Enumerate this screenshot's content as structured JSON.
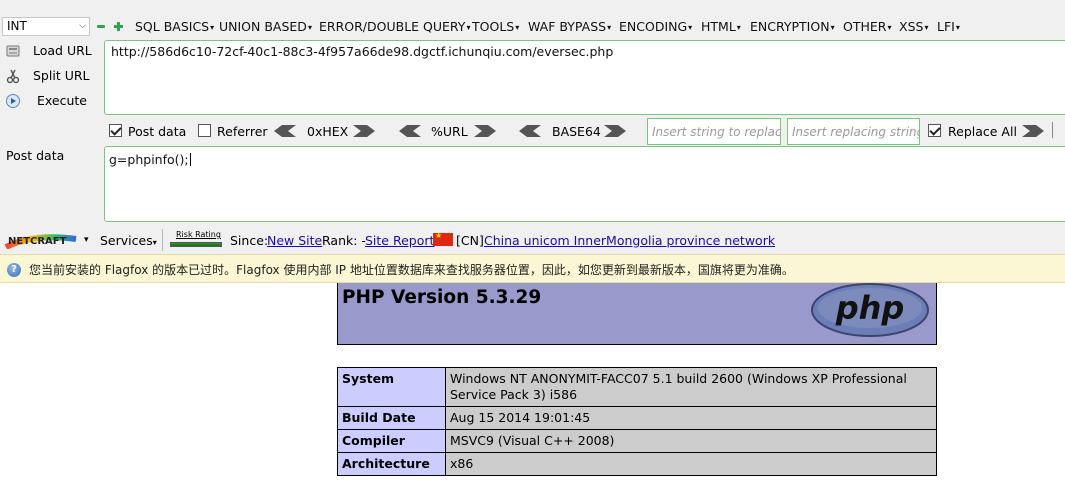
{
  "hackbar": {
    "type_select": {
      "value": "INT"
    },
    "menu": [
      {
        "label": "SQL BASICS"
      },
      {
        "label": "UNION BASED"
      },
      {
        "label": "ERROR/DOUBLE QUERY"
      },
      {
        "label": "TOOLS"
      },
      {
        "label": "WAF BYPASS"
      },
      {
        "label": "ENCODING"
      },
      {
        "label": "HTML"
      },
      {
        "label": "ENCRYPTION"
      },
      {
        "label": "OTHER"
      },
      {
        "label": "XSS"
      },
      {
        "label": "LFI"
      }
    ],
    "side_buttons": {
      "load_url": "Load URL",
      "split_url": "Split URL",
      "execute": "Execute"
    },
    "url_value": "http://586d6c10-72cf-40c1-88c3-4f957a66de98.dgctf.ichunqiu.com/eversec.php",
    "options": {
      "post_data": {
        "label": "Post data",
        "checked": true
      },
      "referrer": {
        "label": "Referrer",
        "checked": false
      },
      "hex": "0xHEX",
      "url": "%URL",
      "base64": "BASE64",
      "insert_string_placeholder": "Insert string to replace",
      "insert_replacing_placeholder": "Insert replacing string",
      "replace_all": {
        "label": "Replace All",
        "checked": true
      }
    },
    "post_label": "Post data",
    "post_value": "g=phpinfo();"
  },
  "netcraft": {
    "logo_text": "NETCRAFT",
    "services": "Services",
    "risk_rating": "Risk Rating",
    "since_label": "Since:",
    "since_value": "New Site",
    "rank_label": "Rank: -",
    "site_report": "Site Report",
    "country": "[CN]",
    "network": "China unicom InnerMongolia province network",
    "flag_color": "#de2910"
  },
  "notice": {
    "text": "您当前安装的 Flagfox 的版本已过时。Flagfox 使用内部 IP 地址位置数据库来查找服务器位置，因此，如您更新到最新版本，国旗将更为准确。"
  },
  "phpinfo": {
    "title": "PHP Version 5.3.29",
    "logo_text": "php",
    "rows": [
      {
        "key": "System",
        "value": "Windows NT ANONYMIT-FACC07 5.1 build 2600 (Windows XP Professional Service Pack 3) i586"
      },
      {
        "key": "Build Date",
        "value": "Aug 15 2014 19:01:45"
      },
      {
        "key": "Compiler",
        "value": "MSVC9 (Visual C++ 2008)"
      },
      {
        "key": "Architecture",
        "value": "x86"
      }
    ],
    "header_color": "#9999cc",
    "key_color": "#ccccff",
    "value_color": "#cccccc"
  }
}
